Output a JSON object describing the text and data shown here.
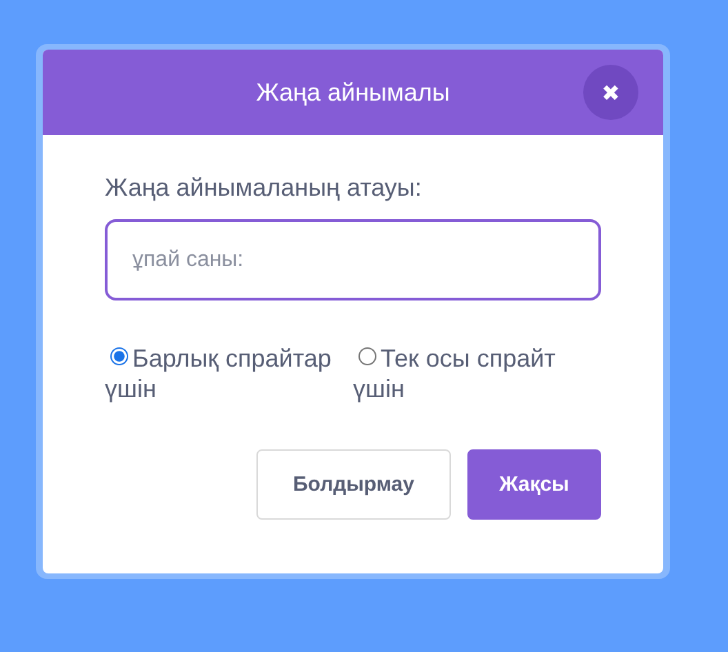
{
  "dialog": {
    "title": "Жаңа айнымалы",
    "close_icon": "✖"
  },
  "name_field": {
    "label": "Жаңа айнымаланың атауы:",
    "placeholder": "ұпай саны:"
  },
  "scope_options": [
    {
      "label": "Барлық спрайтар үшін",
      "selected": true
    },
    {
      "label": "Тек осы спрайт үшін",
      "selected": false
    }
  ],
  "buttons": [
    {
      "label": "Болдырмау",
      "kind": "secondary"
    },
    {
      "label": "Жақсы",
      "kind": "primary"
    }
  ]
}
